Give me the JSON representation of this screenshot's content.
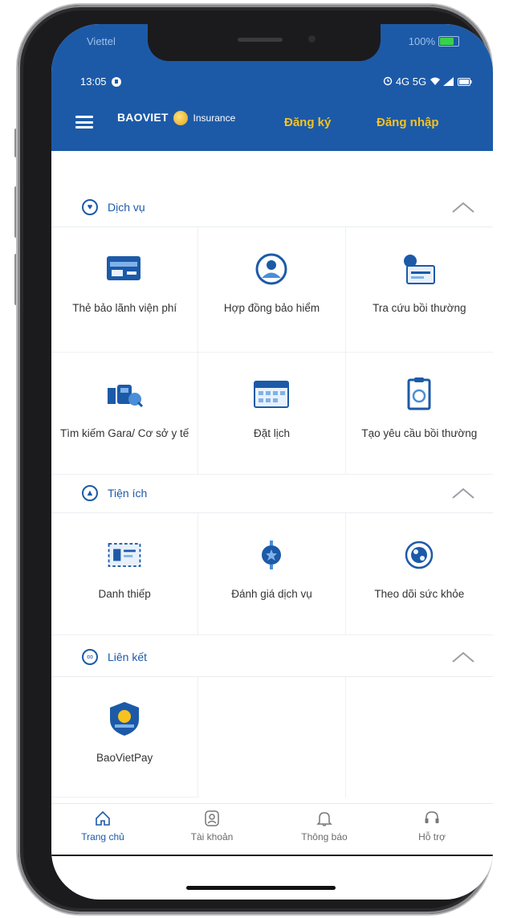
{
  "status_top": {
    "carrier": "Viettel",
    "battery": "100%"
  },
  "status": {
    "time": "13:05",
    "signal": "4G 5G"
  },
  "header": {
    "brand": "BAOVIET",
    "brand_suffix": "Insurance",
    "register_label": "Đăng ký",
    "login_label": "Đăng nhập"
  },
  "sections": {
    "services": {
      "title": "Dịch vụ",
      "items": [
        {
          "label": "Thẻ bảo lãnh viện phí",
          "icon": "card-icon"
        },
        {
          "label": "Hợp đồng bảo hiểm",
          "icon": "user-shield-icon"
        },
        {
          "label": "Tra cứu bồi thường",
          "icon": "lookup-icon"
        },
        {
          "label": "Tìm kiếm Gara/ Cơ sở y tế",
          "icon": "car-search-icon"
        },
        {
          "label": "Đặt lịch",
          "icon": "calendar-icon"
        },
        {
          "label": "Tạo yêu cầu bồi thường",
          "icon": "clipboard-icon"
        }
      ]
    },
    "utilities": {
      "title": "Tiện ích",
      "items": [
        {
          "label": "Danh thiếp",
          "icon": "business-card-icon"
        },
        {
          "label": "Đánh giá dịch vụ",
          "icon": "rating-icon"
        },
        {
          "label": "Theo dõi sức khỏe",
          "icon": "health-icon"
        }
      ]
    },
    "links": {
      "title": "Liên kết",
      "items": [
        {
          "label": "BaoVietPay",
          "icon": "baovietpay-icon"
        }
      ]
    }
  },
  "bottom_nav": [
    {
      "label": "Trang chủ",
      "icon": "home-icon",
      "active": true
    },
    {
      "label": "Tài khoản",
      "icon": "account-icon",
      "active": false
    },
    {
      "label": "Thông báo",
      "icon": "bell-icon",
      "active": false
    },
    {
      "label": "Hỗ trợ",
      "icon": "headset-icon",
      "active": false
    }
  ],
  "colors": {
    "brand_blue": "#1c5aa8",
    "accent_yellow": "#f7c21d",
    "battery_green": "#3ad14a"
  }
}
